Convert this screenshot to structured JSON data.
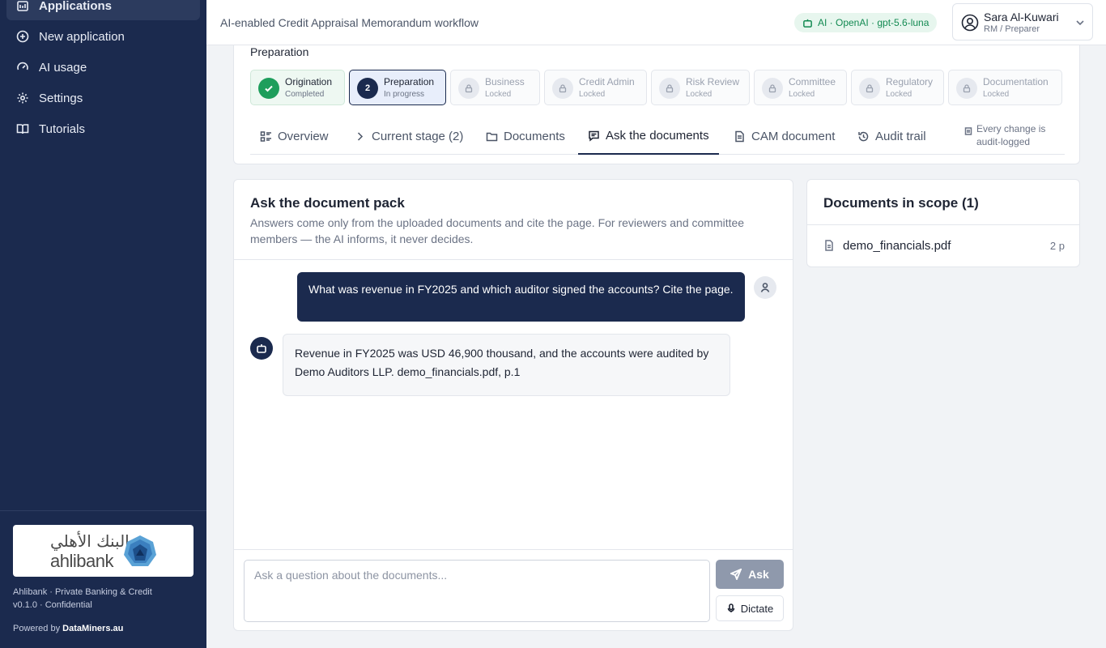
{
  "sidebar": {
    "items": [
      {
        "label": "Applications",
        "icon": "applications-icon",
        "active": true
      },
      {
        "label": "New application",
        "icon": "plus-circle-icon"
      },
      {
        "label": "AI usage",
        "icon": "gauge-icon"
      },
      {
        "label": "Settings",
        "icon": "gear-icon"
      },
      {
        "label": "Tutorials",
        "icon": "book-icon"
      }
    ],
    "logo": {
      "arabic": "البنك الأهلي",
      "latin": "ahlibank"
    },
    "footer": {
      "line1": "Ahlibank · Private Banking & Credit",
      "line2": "v0.1.0 · Confidential",
      "powered_prefix": "Powered by",
      "powered_brand": "DataMiners.au"
    }
  },
  "header": {
    "title": "AI-enabled Credit Appraisal Memorandum workflow",
    "ai_badge": "AI · OpenAI · gpt-5.6-luna",
    "user": {
      "name": "Sara Al-Kuwari",
      "role": "RM / Preparer"
    }
  },
  "workflow": {
    "heading": "Preparation",
    "stages": [
      {
        "name": "Origination",
        "status": "Completed",
        "state": "done"
      },
      {
        "name": "Preparation",
        "status": "In progress",
        "state": "current",
        "number": "2"
      },
      {
        "name": "Business",
        "status": "Locked",
        "state": "locked"
      },
      {
        "name": "Credit Admin",
        "status": "Locked",
        "state": "locked"
      },
      {
        "name": "Risk Review",
        "status": "Locked",
        "state": "locked"
      },
      {
        "name": "Committee",
        "status": "Locked",
        "state": "locked"
      },
      {
        "name": "Regulatory",
        "status": "Locked",
        "state": "locked"
      },
      {
        "name": "Documentation",
        "status": "Locked",
        "state": "locked"
      }
    ],
    "tabs": [
      {
        "label": "Overview"
      },
      {
        "label": "Current stage (2)"
      },
      {
        "label": "Documents"
      },
      {
        "label": "Ask the documents",
        "active": true
      },
      {
        "label": "CAM document"
      },
      {
        "label": "Audit trail"
      }
    ],
    "audit_note_line1": "Every change is",
    "audit_note_line2": "audit-logged"
  },
  "chat": {
    "title": "Ask the document pack",
    "description": "Answers come only from the uploaded documents and cite the page. For reviewers and committee members — the AI informs, it never decides.",
    "messages": [
      {
        "role": "user",
        "text": "What was revenue in FY2025 and which auditor signed the accounts? Cite the page."
      },
      {
        "role": "assistant",
        "text": "Revenue in FY2025 was USD 46,900 thousand, and the accounts were audited by Demo Auditors LLP. demo_financials.pdf, p.1"
      }
    ],
    "input_placeholder": "Ask a question about the documents...",
    "input_value": "",
    "ask_label": "Ask",
    "dictate_label": "Dictate"
  },
  "docs": {
    "title": "Documents in scope (1)",
    "items": [
      {
        "name": "demo_financials.pdf",
        "pages": "2 p"
      }
    ]
  },
  "colors": {
    "sidebar_bg": "#1b2a4e",
    "accent": "#1b2a4e",
    "success": "#1e9e5c",
    "ai_badge_bg": "#e7f6ee",
    "ask_disabled": "#8f99ac"
  }
}
